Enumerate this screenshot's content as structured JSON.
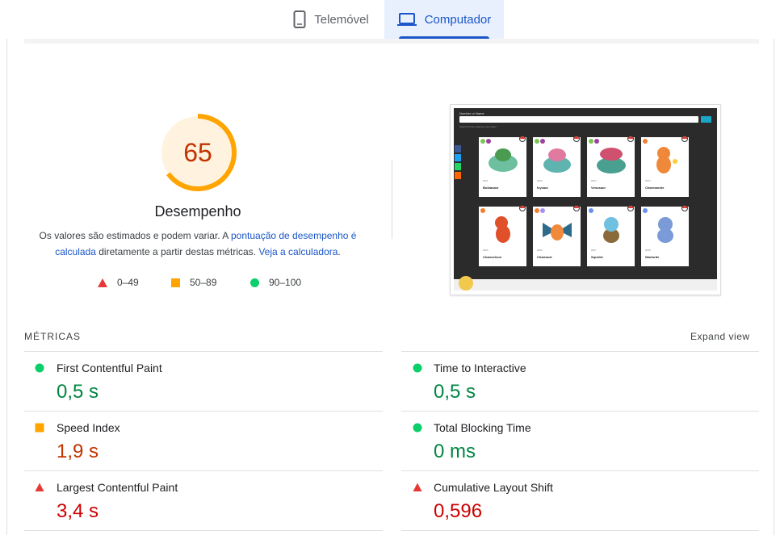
{
  "tabs": [
    {
      "label": "Telemóvel",
      "icon": "smartphone-icon",
      "selected": false
    },
    {
      "label": "Computador",
      "icon": "laptop-icon",
      "selected": true
    }
  ],
  "score": {
    "value": "65",
    "fraction": 0.65,
    "title": "Desempenho",
    "color": "#ffa400"
  },
  "description": {
    "text1": "Os valores são estimados e podem variar. A ",
    "link1": "pontuação de desempenho é calculada",
    "text2": " diretamente a partir destas métricas. ",
    "link2": "Veja a calculadora",
    "text3": "."
  },
  "legend": [
    {
      "range": "0–49",
      "icon": "red-triangle-icon",
      "color": "#e53935"
    },
    {
      "range": "50–89",
      "icon": "orange-square-icon",
      "color": "#ffa400"
    },
    {
      "range": "90–100",
      "icon": "green-circle-icon",
      "color": "#0cce6b"
    }
  ],
  "screenshot": {
    "search_label": "Number or Name",
    "hint": "Search for the pokémon you want!",
    "cards": [
      {
        "num": "#001",
        "name": "Bulbasaur"
      },
      {
        "num": "#002",
        "name": "Ivysaur"
      },
      {
        "num": "#003",
        "name": "Venusaur"
      },
      {
        "num": "#004",
        "name": "Charmander"
      },
      {
        "num": "#005",
        "name": "Charmeleon"
      },
      {
        "num": "#006",
        "name": "Charizard"
      },
      {
        "num": "#007",
        "name": "Squirtle"
      },
      {
        "num": "#008",
        "name": "Wartortle"
      }
    ]
  },
  "metrics": {
    "title": "MÉTRICAS",
    "expand": "Expand view",
    "items": [
      {
        "name": "First Contentful Paint",
        "value": "0,5 s",
        "status": "good"
      },
      {
        "name": "Time to Interactive",
        "value": "0,5 s",
        "status": "good"
      },
      {
        "name": "Speed Index",
        "value": "1,9 s",
        "status": "average"
      },
      {
        "name": "Total Blocking Time",
        "value": "0 ms",
        "status": "good"
      },
      {
        "name": "Largest Contentful Paint",
        "value": "3,4 s",
        "status": "poor"
      },
      {
        "name": "Cumulative Layout Shift",
        "value": "0,596",
        "status": "poor"
      }
    ]
  }
}
